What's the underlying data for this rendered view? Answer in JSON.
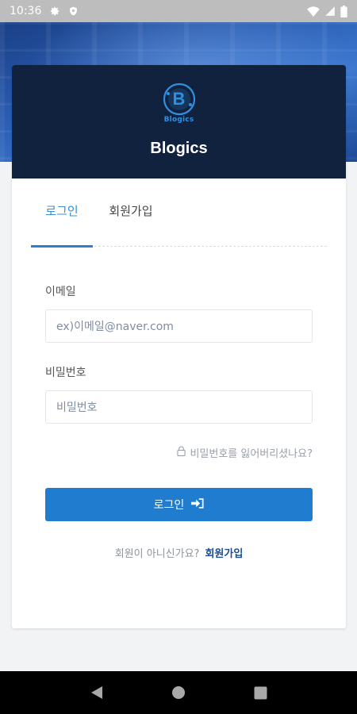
{
  "status_bar": {
    "time": "10:36",
    "icons": [
      "gear-icon",
      "shield-icon",
      "wifi-icon",
      "signal-icon",
      "battery-icon"
    ]
  },
  "brand": {
    "logo_letter": "B",
    "logo_caption": "Blogics",
    "title": "Blogics"
  },
  "tabs": [
    {
      "label": "로그인",
      "active": true
    },
    {
      "label": "회원가입",
      "active": false
    }
  ],
  "form": {
    "email_label": "이메일",
    "email_placeholder": "ex)이메일@naver.com",
    "password_label": "비밀번호",
    "password_placeholder": "비밀번호",
    "forgot_text": "비밀번호를 잃어버리셨나요?",
    "forgot_icon": "lock-icon",
    "login_button": "로그인",
    "login_icon": "sign-in-icon",
    "signup_prompt": "회원이 아니신가요?",
    "signup_link": "회원가입"
  },
  "nav_bar": {
    "icons": [
      "back-icon",
      "home-icon",
      "recents-icon"
    ]
  },
  "colors": {
    "header_bg": "#11223f",
    "accent": "#1f7ccf",
    "active_tab": "#3a8ed8",
    "link": "#1b4d8c"
  }
}
